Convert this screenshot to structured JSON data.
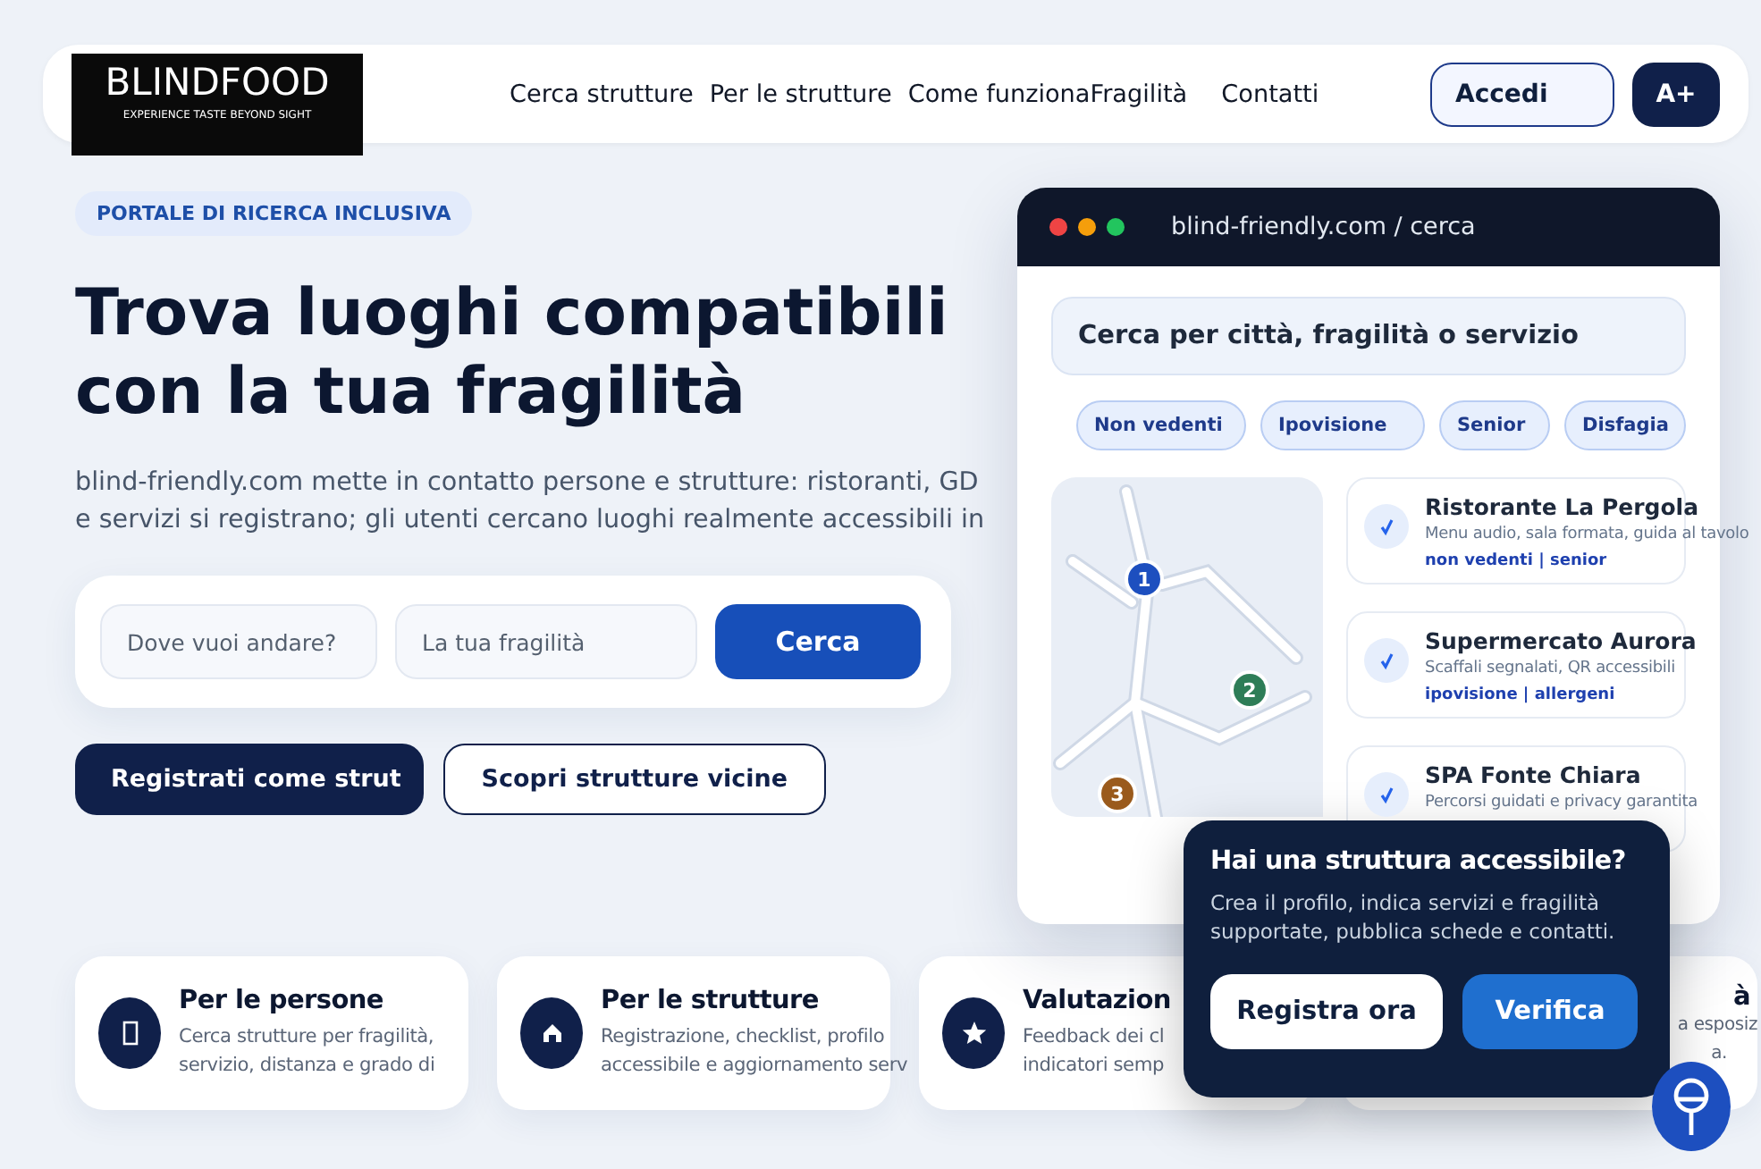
{
  "header": {
    "logo": {
      "title": "BLINDFOOD",
      "tagline": "EXPERIENCE TASTE BEYOND SIGHT"
    },
    "nav": [
      {
        "label": "Cerca strutture"
      },
      {
        "label": "Per le strutture"
      },
      {
        "label": "Come funziona"
      },
      {
        "label": "Fragilità"
      },
      {
        "label": "Contatti"
      }
    ],
    "login_button": "Accedi",
    "font_size_button": "A+"
  },
  "hero": {
    "badge": "PORTALE DI RICERCA INCLUSIVA",
    "title": "Trova luoghi compatibili con la tua fragilità",
    "description_lines": [
      "blind-friendly.com mette in contatto persone e strutture: ristoranti, GD",
      "e servizi si registrano; gli utenti cercano luoghi realmente accessibili in"
    ],
    "search": {
      "place_placeholder": "Dove vuoi andare?",
      "fragility_placeholder": "La tua fragilità",
      "button": "Cerca"
    },
    "register_button": "Registrati come strut",
    "discover_button": "Scopri strutture vicine"
  },
  "mockup": {
    "url": "blind-friendly.com / cerca",
    "search_text": "Cerca per città, fragilità o servizio",
    "chips": [
      {
        "label": "Non vedenti"
      },
      {
        "label": "Ipovisione"
      },
      {
        "label": "Senior"
      },
      {
        "label": "Disfagia"
      }
    ],
    "map_pins": [
      {
        "label": "1",
        "color": "#1d4fbf"
      },
      {
        "label": "2",
        "color": "#2e7d57"
      },
      {
        "label": "3",
        "color": "#9a5a1c"
      }
    ],
    "results": [
      {
        "name": "Ristorante La Pergola",
        "description": "Menu audio, sala formata, guida al tavolo",
        "tags": "non vedenti | senior"
      },
      {
        "name": "Supermercato Aurora",
        "description": "Scaffali segnalati, QR accessibili",
        "tags": "ipovisione | allergeni"
      },
      {
        "name": "SPA Fonte Chiara",
        "description": "Percorsi guidati e privacy garantita"
      }
    ]
  },
  "popup": {
    "title": "Hai una struttura accessibile?",
    "text": "Crea il profilo, indica servizi e fragilità supportate, pubblica schede e contatti.",
    "register_button": "Registra ora",
    "verify_button": "Verifica"
  },
  "features": [
    {
      "title": "Per le persone",
      "lines": [
        "Cerca strutture per fragilità,",
        "servizio, distanza e grado di"
      ]
    },
    {
      "title": "Per le strutture",
      "lines": [
        "Registrazione, checklist, profilo",
        "accessibile e aggiornamento serv"
      ]
    },
    {
      "title": "Valutazion",
      "lines": [
        "Feedback dei cl",
        "indicatori semp"
      ]
    },
    {
      "title": "à",
      "lines": [
        "a esposiz",
        "a."
      ]
    }
  ]
}
